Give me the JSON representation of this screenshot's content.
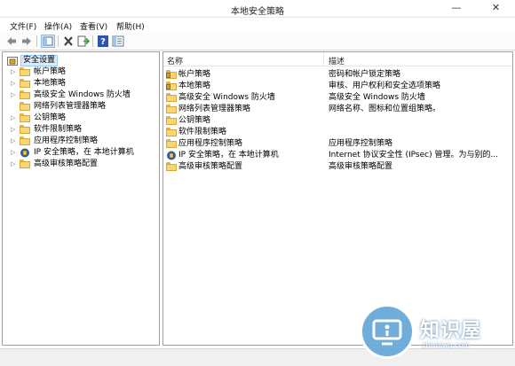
{
  "window": {
    "title": "本地安全策略"
  },
  "menu": [
    "文件(F)",
    "操作(A)",
    "查看(V)",
    "帮助(H)"
  ],
  "toolbar": {
    "buttons": [
      "back-icon",
      "forward-icon",
      "show-tree-icon",
      "delete-icon",
      "export-icon",
      "help-icon",
      "properties-icon"
    ]
  },
  "tree": {
    "root": "安全设置",
    "items": [
      {
        "label": "帐户策略",
        "icon": "folder-icon",
        "expandable": true
      },
      {
        "label": "本地策略",
        "icon": "folder-icon",
        "expandable": true
      },
      {
        "label": "高级安全 Windows 防火墙",
        "icon": "folder-icon",
        "expandable": true
      },
      {
        "label": "网络列表管理器策略",
        "icon": "folder-icon",
        "expandable": false
      },
      {
        "label": "公钥策略",
        "icon": "folder-icon",
        "expandable": true
      },
      {
        "label": "软件限制策略",
        "icon": "folder-icon",
        "expandable": true
      },
      {
        "label": "应用程序控制策略",
        "icon": "folder-icon",
        "expandable": true
      },
      {
        "label": "IP 安全策略，在 本地计算机",
        "icon": "ipsec-icon",
        "expandable": true
      },
      {
        "label": "高级审核策略配置",
        "icon": "folder-icon",
        "expandable": true
      }
    ]
  },
  "list": {
    "columns": [
      "名称",
      "描述"
    ],
    "rows": [
      {
        "name": "帐户策略",
        "desc": "密码和帐户锁定策略",
        "icon": "policy-folder-icon"
      },
      {
        "name": "本地策略",
        "desc": "审核、用户权利和安全选项策略",
        "icon": "policy-folder-icon"
      },
      {
        "name": "高级安全 Windows 防火墙",
        "desc": "高级安全 Windows 防火墙",
        "icon": "folder-icon"
      },
      {
        "name": "网络列表管理器策略",
        "desc": "网络名称、图标和位置组策略。",
        "icon": "folder-icon"
      },
      {
        "name": "公钥策略",
        "desc": "",
        "icon": "folder-icon"
      },
      {
        "name": "软件限制策略",
        "desc": "",
        "icon": "folder-icon"
      },
      {
        "name": "应用程序控制策略",
        "desc": "应用程序控制策略",
        "icon": "folder-icon"
      },
      {
        "name": "IP 安全策略，在 本地计算机",
        "desc": "Internet 协议安全性 (IPsec) 管理。为与别的...",
        "icon": "ipsec-icon"
      },
      {
        "name": "高级审核策略配置",
        "desc": "高级审核策略配置",
        "icon": "folder-icon"
      }
    ]
  },
  "watermark": {
    "text": "知识屋",
    "url": "zhishiwu.com"
  }
}
